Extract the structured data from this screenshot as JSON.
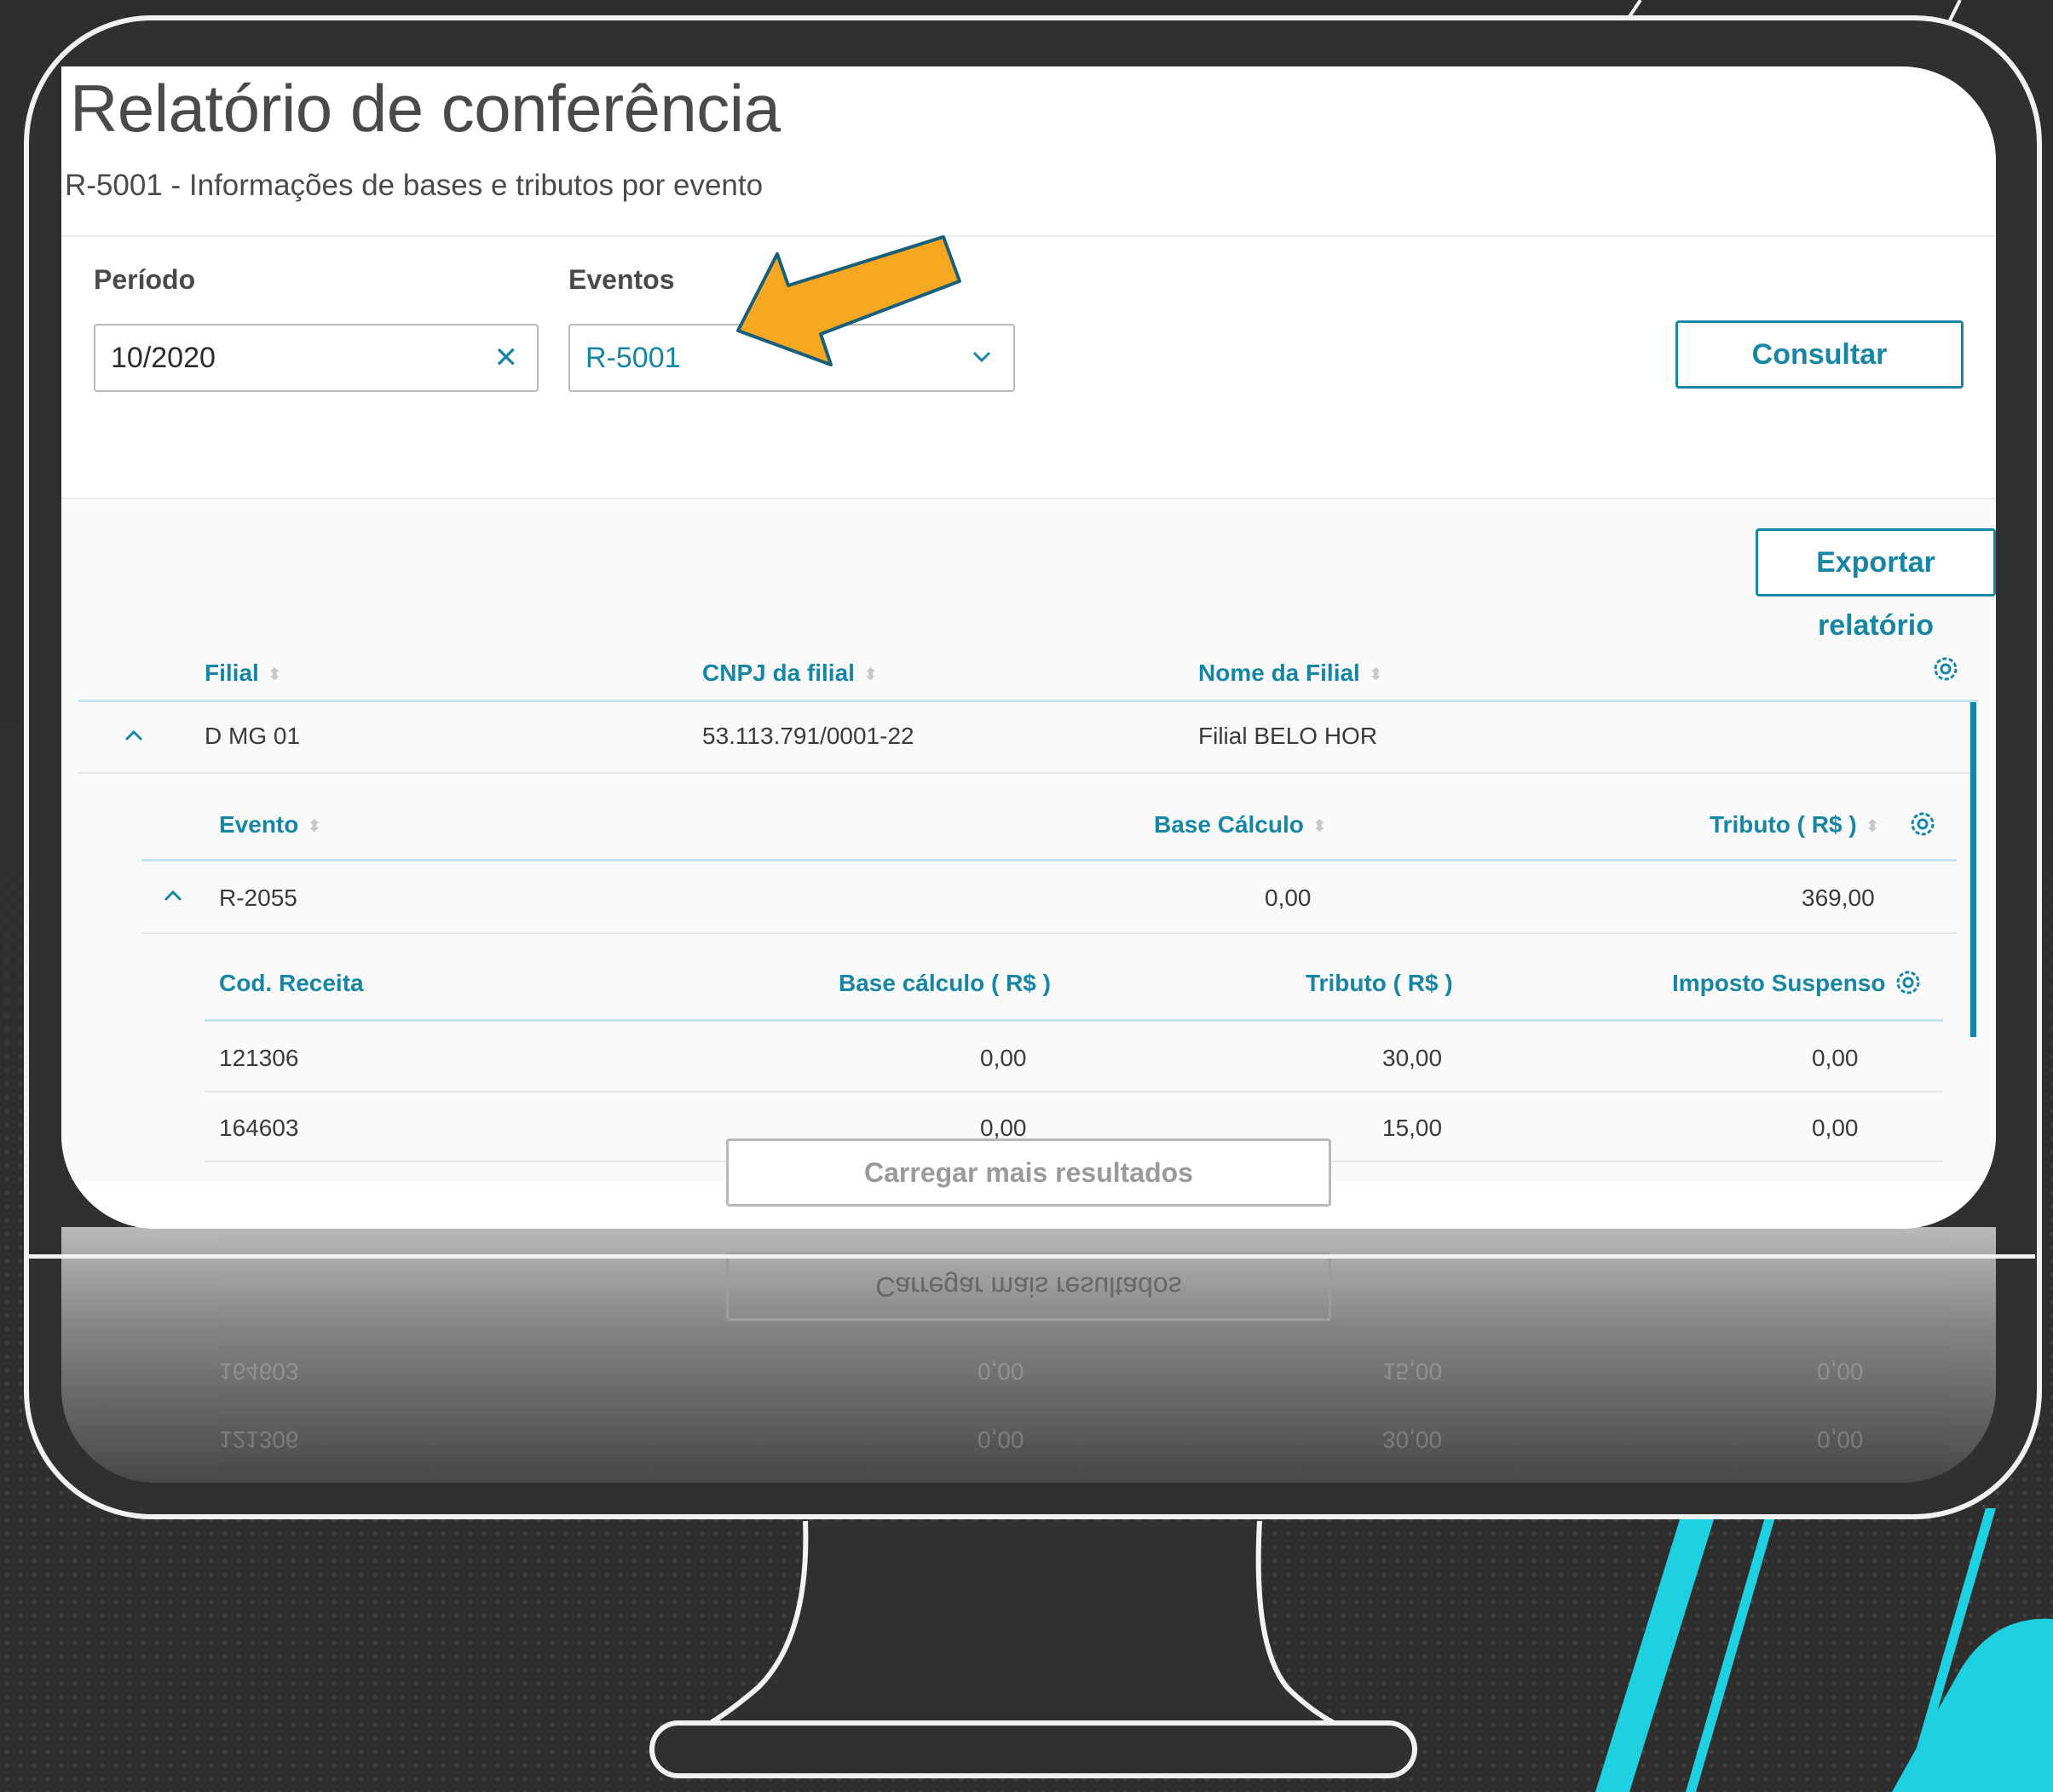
{
  "header": {
    "title": "Relatório de conferência",
    "subtitle": "R-5001 - Informações de bases e tributos por evento"
  },
  "filters": {
    "period_label": "Período",
    "period_value": "10/2020",
    "events_label": "Eventos",
    "events_value": "R-5001",
    "consult_label": "Consultar"
  },
  "actions": {
    "export_label": "Exportar relatório",
    "load_more_label": "Carregar mais resultados"
  },
  "branch_table": {
    "columns": [
      "Filial",
      "CNPJ da filial",
      "Nome da Filial"
    ],
    "row": {
      "filial": "D MG 01",
      "cnpj": "53.113.791/0001-22",
      "nome": "Filial BELO HOR"
    }
  },
  "event_table": {
    "columns": [
      "Evento",
      "Base Cálculo",
      "Tributo ( R$ )"
    ],
    "row": {
      "evento": "R-2055",
      "base": "0,00",
      "tributo": "369,00"
    }
  },
  "revenue_table": {
    "columns": [
      "Cod. Receita",
      "Base cálculo ( R$ )",
      "Tributo ( R$ )",
      "Imposto Suspenso"
    ],
    "rows": [
      {
        "cod": "121306",
        "base": "0,00",
        "tributo": "30,00",
        "suspenso": "0,00"
      },
      {
        "cod": "164603",
        "base": "0,00",
        "tributo": "15,00",
        "suspenso": "0,00"
      }
    ]
  },
  "colors": {
    "accent": "#1786a4",
    "arrow": "#f7a823",
    "decor_cyan": "#1ed0e0"
  },
  "icons": [
    "clear-icon",
    "chevron-down-icon",
    "sort-icon",
    "gear-icon",
    "chevron-up-icon",
    "arrow-pointer-icon"
  ]
}
